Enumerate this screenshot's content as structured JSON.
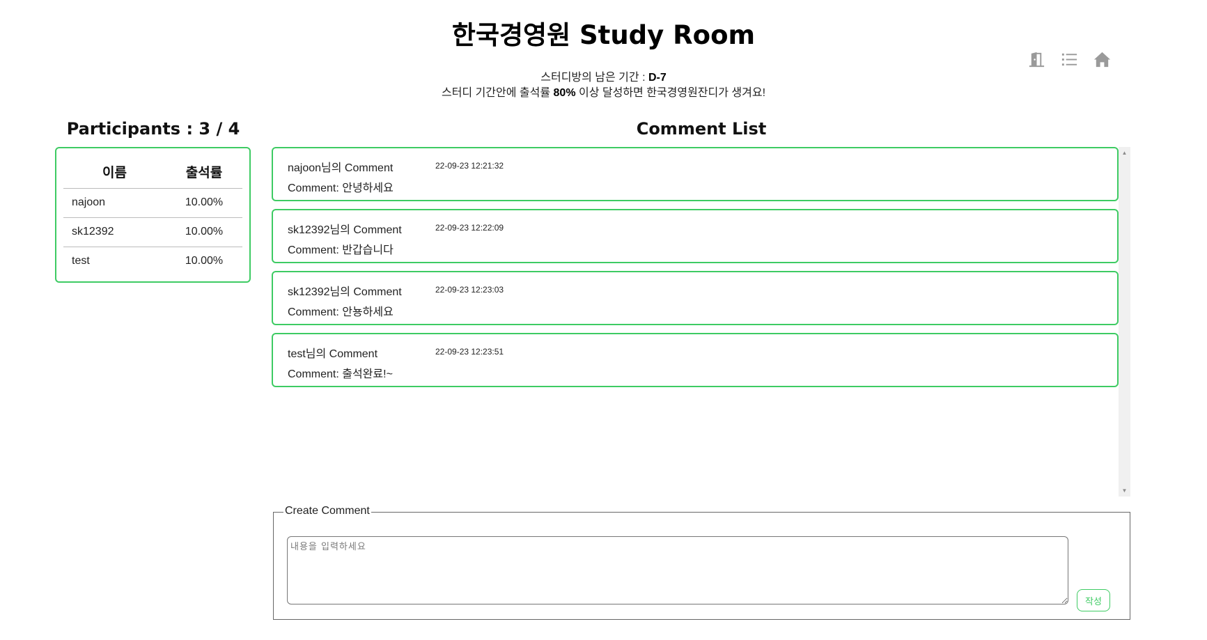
{
  "header": {
    "title": "한국경영원 Study Room",
    "remaining_prefix": "스터디방의 남은 기간 : ",
    "remaining_value": "D-7",
    "goal_prefix": "스터디 기간안에 출석률 ",
    "goal_value": "80%",
    "goal_suffix": " 이상 달성하면 한국경영원잔디가 생겨요!"
  },
  "top_icons": [
    "exit-door-icon",
    "list-icon",
    "home-icon"
  ],
  "participants": {
    "title": "Participants : 3 / 4",
    "columns": [
      "이름",
      "출석률"
    ],
    "rows": [
      {
        "name": "najoon",
        "rate": "10.00%"
      },
      {
        "name": "sk12392",
        "rate": "10.00%"
      },
      {
        "name": "test",
        "rate": "10.00%"
      }
    ]
  },
  "comments": {
    "title": "Comment List",
    "items": [
      {
        "author": "najoon님의 Comment",
        "time": "22-09-23 12:21:32",
        "body": "Comment: 안녕하세요"
      },
      {
        "author": "sk12392님의 Comment",
        "time": "22-09-23 12:22:09",
        "body": "Comment: 반갑습니다"
      },
      {
        "author": "sk12392님의 Comment",
        "time": "22-09-23 12:23:03",
        "body": "Comment: 안뇽하세요"
      },
      {
        "author": "test님의 Comment",
        "time": "22-09-23 12:23:51",
        "body": "Comment: 출석완료!~"
      }
    ]
  },
  "create": {
    "legend": "Create Comment",
    "placeholder": "내용을 입력하세요",
    "submit_label": "작성"
  },
  "colors": {
    "accent": "#3ecb63",
    "icon": "#9a9a9a"
  }
}
